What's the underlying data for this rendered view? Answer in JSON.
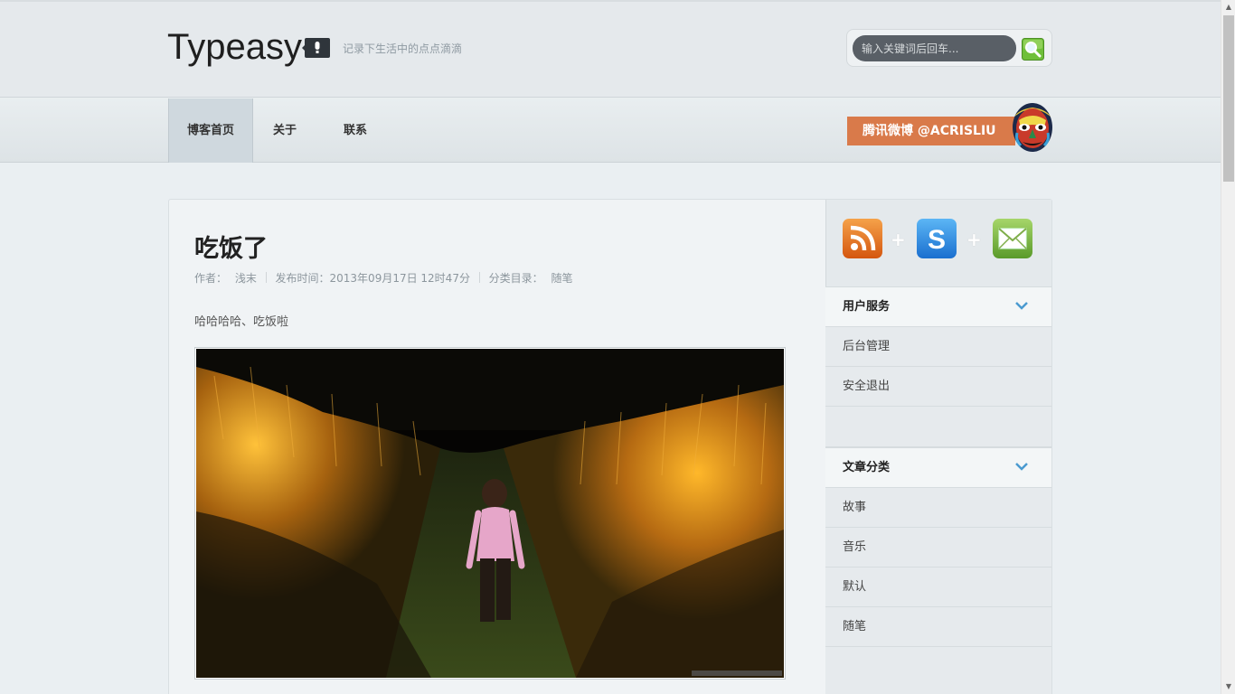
{
  "site": {
    "title": "Typeasy",
    "tagline": "记录下生活中的点点滴滴"
  },
  "search": {
    "placeholder": "输入关键词后回车..."
  },
  "nav": {
    "items": [
      {
        "label": "博客首页",
        "active": true
      },
      {
        "label": "关于",
        "active": false
      },
      {
        "label": "联系",
        "active": false
      }
    ],
    "weibo_label": "腾讯微博 @ACRISLIU"
  },
  "post": {
    "title": "吃饭了",
    "author_label": "作者：",
    "author": "浅末",
    "published": "发布时间：2013年09月17日 12时47分",
    "category_label": "分类目录：",
    "category": "随笔",
    "excerpt": "哈哈哈哈、吃饭啦"
  },
  "sidebar": {
    "social": [
      {
        "icon": "rss-icon",
        "color": "#e8741c"
      },
      {
        "icon": "skype-icon",
        "color": "#1f7fd8"
      },
      {
        "icon": "mail-icon",
        "color": "#6ca53a"
      }
    ],
    "plus": "+",
    "user_service": {
      "title": "用户服务",
      "items": [
        "后台管理",
        "安全退出"
      ]
    },
    "categories": {
      "title": "文章分类",
      "items": [
        "故事",
        "音乐",
        "默认",
        "随笔"
      ]
    }
  },
  "colors": {
    "accent_orange": "#d97a4a",
    "background": "#eaeff2",
    "nav_active": "#cfd8de"
  }
}
